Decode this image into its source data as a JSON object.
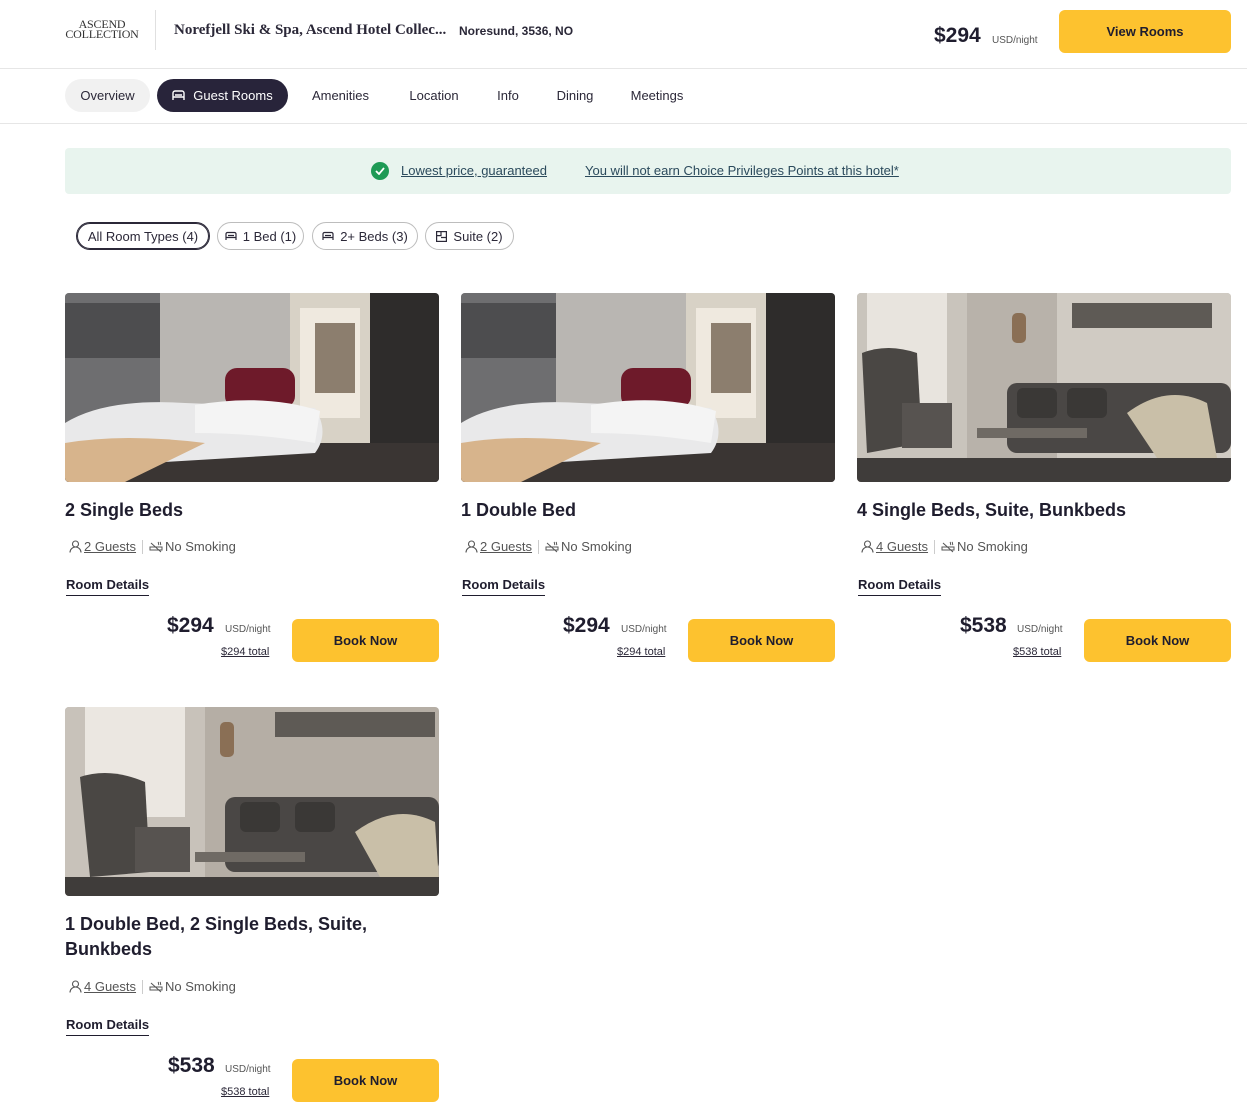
{
  "header": {
    "logo_line1": "ASCEND",
    "logo_line2": "COLLECTION",
    "hotel_name": "Norefjell Ski & Spa, Ascend Hotel Collec...",
    "location": "Noresund, 3536, NO",
    "price": "$294",
    "price_unit": "USD/night",
    "view_rooms_label": "View Rooms"
  },
  "tabs": [
    {
      "label": "Overview"
    },
    {
      "label": "Guest Rooms"
    },
    {
      "label": "Amenities"
    },
    {
      "label": "Location"
    },
    {
      "label": "Info"
    },
    {
      "label": "Dining"
    },
    {
      "label": "Meetings"
    }
  ],
  "banner": {
    "lowest_price": "Lowest price, guaranteed",
    "points_note": "You will not earn Choice Privileges Points at this hotel*"
  },
  "filters": [
    {
      "label": "All Room Types (4)"
    },
    {
      "label": "1 Bed (1)"
    },
    {
      "label": "2+ Beds (3)"
    },
    {
      "label": "Suite (2)"
    }
  ],
  "rooms": [
    {
      "title": "2 Single Beds",
      "guests": "2 Guests",
      "smoking": "No Smoking",
      "details": "Room Details",
      "price": "$294",
      "unit": "USD/night",
      "total": "$294 total",
      "book": "Book Now"
    },
    {
      "title": "1 Double Bed",
      "guests": "2 Guests",
      "smoking": "No Smoking",
      "details": "Room Details",
      "price": "$294",
      "unit": "USD/night",
      "total": "$294 total",
      "book": "Book Now"
    },
    {
      "title": "4 Single Beds, Suite, Bunkbeds",
      "guests": "4 Guests",
      "smoking": "No Smoking",
      "details": "Room Details",
      "price": "$538",
      "unit": "USD/night",
      "total": "$538 total",
      "book": "Book Now"
    },
    {
      "title": "1 Double Bed, 2 Single Beds, Suite, Bunkbeds",
      "guests": "4 Guests",
      "smoking": "No Smoking",
      "details": "Room Details",
      "price": "$538",
      "unit": "USD/night",
      "total": "$538 total",
      "book": "Book Now"
    }
  ],
  "colors": {
    "accent_yellow": "#fdc22f",
    "active_tab": "#28243a",
    "banner_bg": "#e8f4ee",
    "check_green": "#1e9a55"
  }
}
